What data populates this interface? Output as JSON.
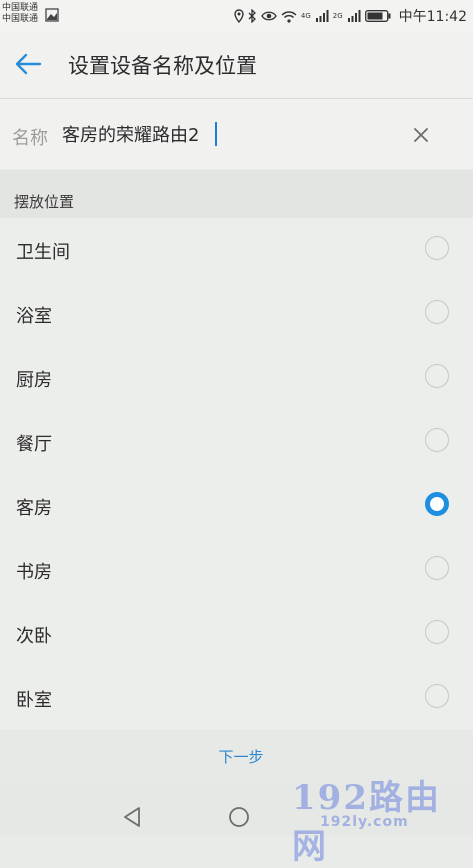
{
  "status_bar": {
    "carrier_1": "中国联通",
    "carrier_2": "中国联通",
    "network_1": "4G",
    "network_2": "2G",
    "time": "中午11:42"
  },
  "header": {
    "title": "设置设备名称及位置"
  },
  "name_field": {
    "label": "名称",
    "value": "客房的荣耀路由2"
  },
  "location": {
    "section_title": "摆放位置",
    "options": [
      {
        "label": "卫生间",
        "selected": false
      },
      {
        "label": "浴室",
        "selected": false
      },
      {
        "label": "厨房",
        "selected": false
      },
      {
        "label": "餐厅",
        "selected": false
      },
      {
        "label": "客房",
        "selected": true
      },
      {
        "label": "书房",
        "selected": false
      },
      {
        "label": "次卧",
        "selected": false
      },
      {
        "label": "卧室",
        "selected": false
      }
    ]
  },
  "footer": {
    "next_label": "下一步"
  },
  "watermark": {
    "main": "192路由网",
    "sub": "192ly.com"
  },
  "colors": {
    "accent": "#1e8ee0",
    "next_text": "#2f86cf",
    "background": "#e9ebe9"
  },
  "icons": {
    "back": "arrow-left-icon",
    "clear": "close-icon",
    "nav_back": "triangle-back-icon",
    "nav_home": "circle-home-icon"
  }
}
